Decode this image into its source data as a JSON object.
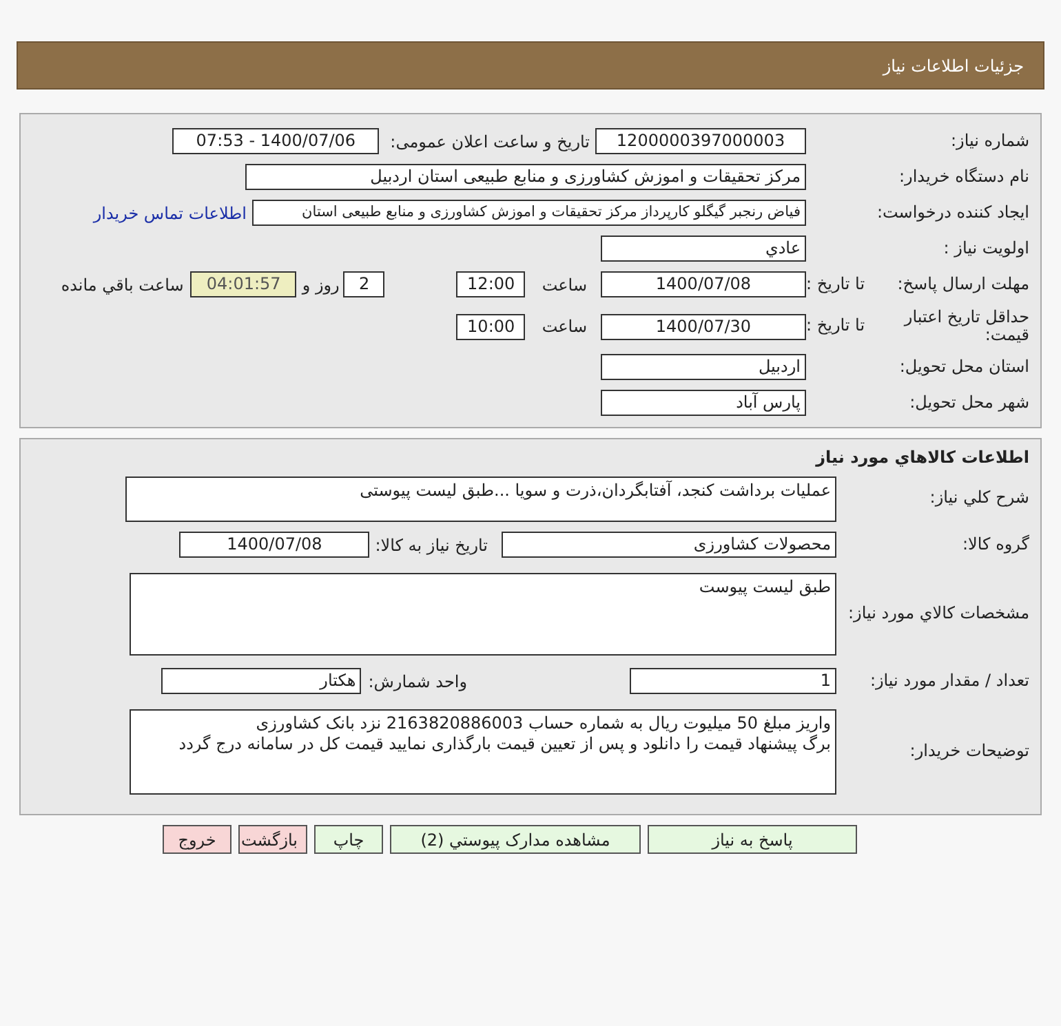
{
  "header": {
    "title": "جزئیات اطلاعات نیاز"
  },
  "need_info": {
    "need_number": {
      "label": "شماره نیاز:",
      "value": "1200000397000003"
    },
    "announce": {
      "label": "تاریخ و ساعت اعلان عمومی:",
      "value": "1400/07/06 - 07:53"
    },
    "buyer": {
      "label": "نام دستگاه خریدار:",
      "value": "مرکز تحقیقات و اموزش کشاورزی و منابع طبیعی استان اردبیل"
    },
    "requester": {
      "label": "ایجاد کننده درخواست:",
      "value": "فیاض رنجبر گیگلو کارپرداز مرکز تحقیقات و اموزش کشاورزی و منابع طبیعی استان",
      "link": "اطلاعات تماس خریدار"
    },
    "priority": {
      "label": "اولویت نیاز :",
      "value": "عادي"
    },
    "deadline": {
      "label": "مهلت ارسال پاسخ:",
      "to_label": "تا تاریخ :",
      "date": "1400/07/08",
      "time_label": "ساعت",
      "time": "12:00",
      "days": "2",
      "days_label": "روز و",
      "remaining": "04:01:57",
      "remaining_label": "ساعت باقي مانده"
    },
    "validity": {
      "label": "حداقل تاریخ اعتبار قیمت:",
      "to_label": "تا تاریخ :",
      "date": "1400/07/30",
      "time_label": "ساعت",
      "time": "10:00"
    },
    "province": {
      "label": "استان محل تحویل:",
      "value": "اردبیل"
    },
    "city": {
      "label": "شهر محل تحویل:",
      "value": "پارس آباد"
    }
  },
  "goods": {
    "title": "اطلاعات كالاهاي مورد نياز",
    "summary": {
      "label": "شرح كلي نياز:",
      "value": "عملیات برداشت کنجد، آفتابگردان،ذرت و سویا ...طبق لیست پیوستی"
    },
    "group": {
      "label": "گروه کالا:",
      "value": "محصولات کشاورزی",
      "date_label": "تاریخ نیاز به کالا:",
      "date": "1400/07/08"
    },
    "specs": {
      "label": "مشخصات كالاي مورد نياز:",
      "value": "طبق لیست پیوست"
    },
    "quantity": {
      "label": "تعداد / مقدار مورد نیاز:",
      "value": "1",
      "unit_label": "واحد شمارش:",
      "unit": "هکتار"
    },
    "notes": {
      "label": "توضیحات خریدار:",
      "lines": [
        "واریز مبلغ 50 میلیوت ریال به شماره حساب 2163820886003 نزد بانک کشاورزی",
        "برگ پیشنهاد قیمت را دانلود و پس از تعیین قیمت بارگذاری نمایید قیمت کل در سامانه درج گردد"
      ]
    }
  },
  "buttons": [
    {
      "label": "پاسخ به نیاز",
      "kind": "primary"
    },
    {
      "label": "مشاهده مدارک پیوستي (2)",
      "kind": "primary"
    },
    {
      "label": "چاپ",
      "kind": "primary"
    },
    {
      "label": "بازگشت",
      "kind": "danger"
    },
    {
      "label": "خروج",
      "kind": "danger"
    }
  ]
}
